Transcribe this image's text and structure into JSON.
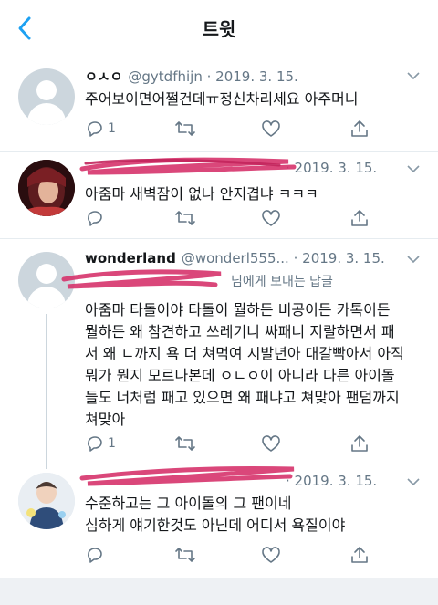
{
  "header": {
    "title": "트윗"
  },
  "tweets": [
    {
      "name": "ㅇㅅㅇ",
      "handle": "@gytdfhijn",
      "date": "· 2019. 3. 15.",
      "text": "주어보이면어쩔건데ㅠ정신차리세요 아주머니",
      "reply_count": "1"
    },
    {
      "name": "",
      "handle": "",
      "date": "· 2019. 3. 15.",
      "text": "아줌마 새벽잠이 없나 안지겹냐 ㅋㅋㅋ",
      "reply_count": ""
    },
    {
      "name": "wonderland",
      "handle": "@wonderl555...",
      "date": "· 2019. 3. 15.",
      "reply_to_suffix": "님에게 보내는 답글",
      "text_lines": [
        "아줌마 타돌이야 타돌이 뭘하든 비공이든 카톡이든",
        "뭘하든 왜 참견하고 쓰레기니 싸패니 지랄하면서 패",
        "서 왜 ㄴ까지 욕 더 쳐먹여 시발년아 대갈빡아서 아직",
        "뭐가 뭔지 모르나본데 ㅇㄴㅇ이 아니라 다른 아이돌",
        "들도 너처럼 패고 있으면 왜 패냐고 쳐맞아 팬덤까지",
        "쳐맞아"
      ],
      "reply_count": "1"
    },
    {
      "name": "",
      "handle": "",
      "date": "· 2019. 3. 15.",
      "text_lines": [
        "수준하고는 그 아이돌의 그 팬이네",
        "심하게 얘기한것도 아닌데 어디서 욕질이야"
      ],
      "reply_count": ""
    }
  ],
  "colors": {
    "accent": "#1da1f2",
    "meta_gray": "#657786",
    "scribble": "#d6336c"
  },
  "icons": [
    "back-chevron-icon",
    "reply-icon",
    "retweet-icon",
    "like-icon",
    "share-icon",
    "caret-down-icon"
  ]
}
